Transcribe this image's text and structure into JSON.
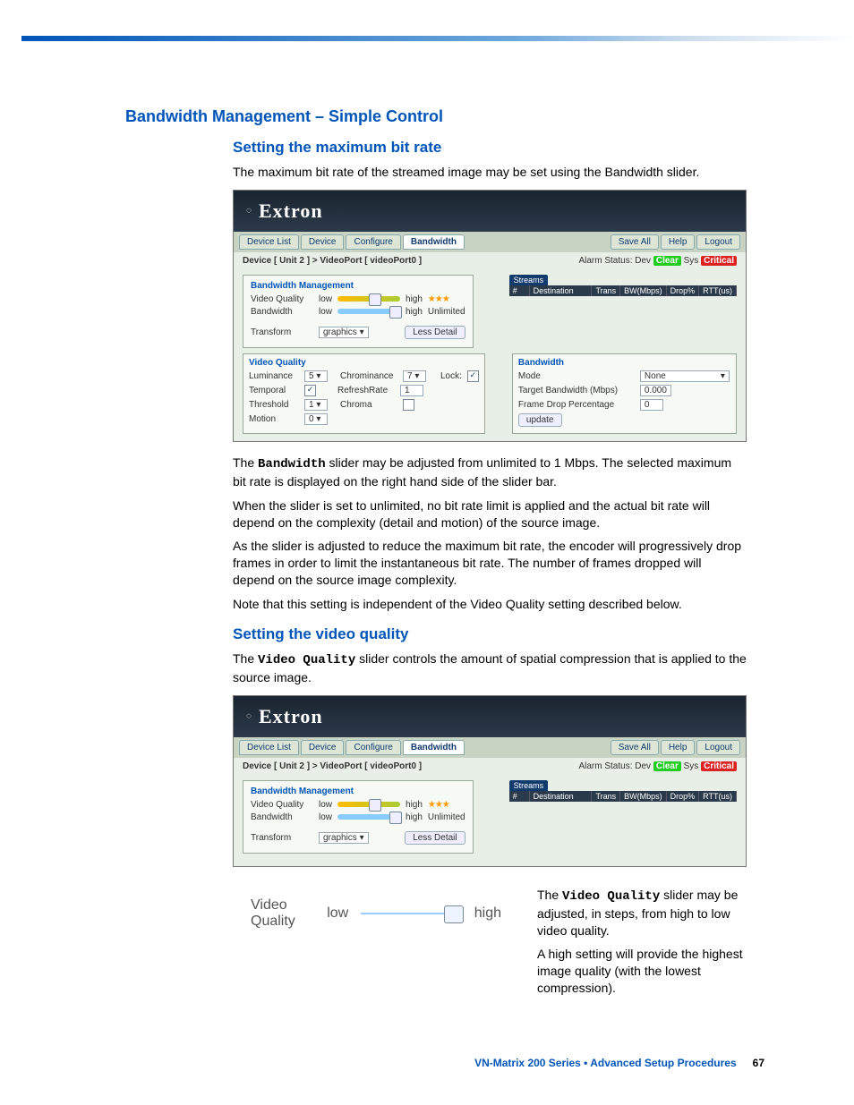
{
  "headings": {
    "h1": "Bandwidth Management – Simple Control",
    "h2a": "Setting the maximum bit rate",
    "h2b": "Setting the video quality"
  },
  "paragraphs": {
    "p1": "The maximum bit rate of the streamed image may be set using the Bandwidth slider.",
    "p2a": "The ",
    "p2b": "Bandwidth",
    "p2c": " slider may be adjusted from unlimited to 1 Mbps. The selected maximum bit rate is displayed on the right hand side of the slider bar.",
    "p3": "When the slider is set to unlimited, no bit rate limit is applied and the actual bit rate will depend on the complexity (detail and motion) of the source image.",
    "p4": "As the slider is adjusted to reduce the maximum bit rate, the encoder will progressively drop frames in order to limit the instantaneous bit rate. The number of frames dropped will depend on the source image complexity.",
    "p5": "Note that this setting is independent of the Video Quality setting described below.",
    "p6a": "The ",
    "p6b": "Video Quality",
    "p6c": " slider controls the amount of spatial compression that is applied to the source image.",
    "p7a": "The ",
    "p7b": "Video Quality",
    "p7c": " slider may be adjusted, in steps, from high to low video quality.",
    "p8": "A high setting will provide the highest image quality (with the lowest compression)."
  },
  "shot": {
    "brand": "Extron",
    "tabs": {
      "deviceList": "Device List",
      "device": "Device",
      "configure": "Configure",
      "bandwidth": "Bandwidth"
    },
    "rightBtns": {
      "saveAll": "Save All",
      "help": "Help",
      "logout": "Logout"
    },
    "crumb": "Device [ Unit 2 ]  >  VideoPort [ videoPort0 ]",
    "alarmLabel": "Alarm Status:",
    "alarmDev": "Dev",
    "alarmClear": "Clear",
    "alarmSys": "Sys",
    "alarmCrit": "Critical",
    "bm": {
      "title": "Bandwidth Management",
      "vq": "Video Quality",
      "low": "low",
      "high": "high",
      "bw": "Bandwidth",
      "unl": "Unlimited",
      "transform": "Transform",
      "graphics": "graphics  ▾",
      "less": "Less Detail"
    },
    "streams": {
      "tab": "Streams",
      "hdrs": {
        "num": "#",
        "dest": "Destination",
        "trans": "Trans",
        "bw": "BW(Mbps)",
        "drop": "Drop%",
        "rtt": "RTT(us)"
      }
    },
    "vqpanel": {
      "title": "Video Quality",
      "lum": "Luminance",
      "lumv": "5",
      "chrom": "Chrominance",
      "chromv": "7",
      "lock": "Lock:",
      "temp": "Temporal",
      "rr": "RefreshRate",
      "rrv": "1",
      "thr": "Threshold",
      "thrv": "1",
      "chroma": "Chroma",
      "motion": "Motion",
      "motionv": "0"
    },
    "bwpanel": {
      "title": "Bandwidth",
      "mode": "Mode",
      "modev": "None",
      "tbw": "Target Bandwidth (Mbps)",
      "tbwv": "0.000",
      "fdp": "Frame Drop Percentage",
      "fdpv": "0",
      "update": "update"
    }
  },
  "vqdemo": {
    "label": "Video Quality",
    "low": "low",
    "high": "high"
  },
  "footer": {
    "text": "VN-Matrix 200 Series  •  Advanced Setup Procedures",
    "page": "67"
  }
}
